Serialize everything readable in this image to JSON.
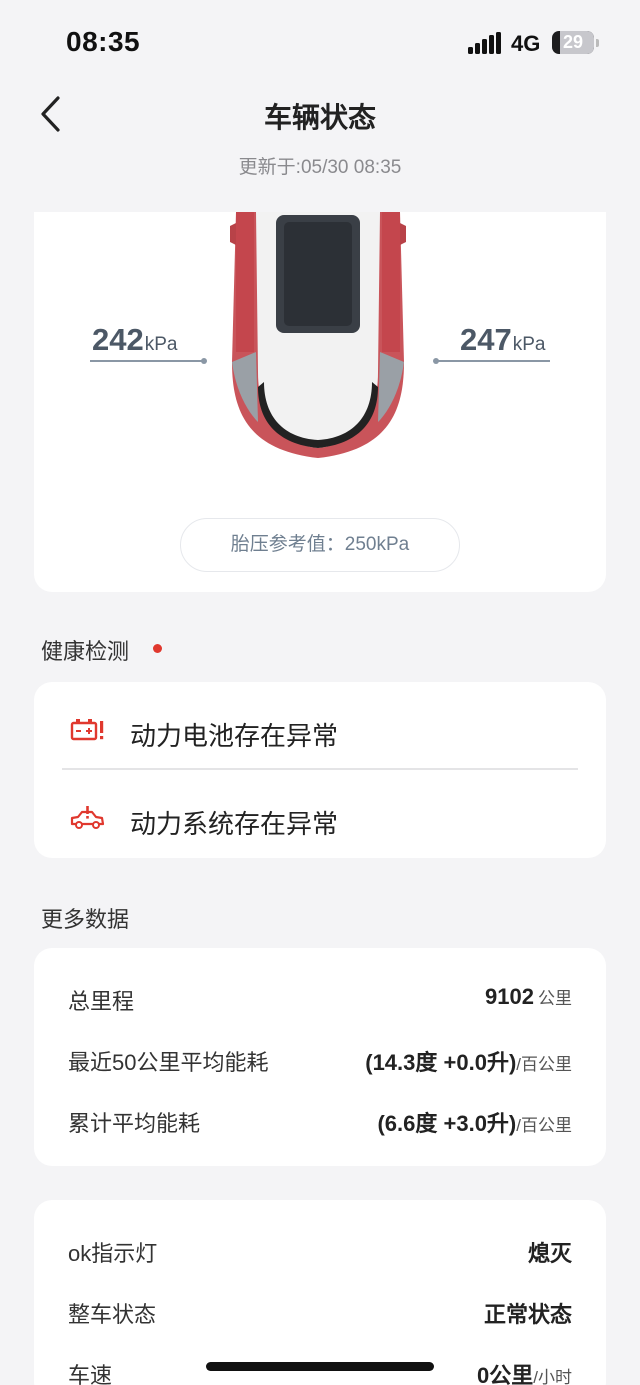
{
  "status_bar": {
    "time": "08:35",
    "network": "4G",
    "battery": "29"
  },
  "header": {
    "title": "车辆状态",
    "update_time": "更新于:05/30 08:35"
  },
  "tire_pressure": {
    "left_value": "242",
    "left_unit": "kPa",
    "right_value": "247",
    "right_unit": "kPa",
    "reference": "胎压参考值：250kPa"
  },
  "health": {
    "section_title": "健康检测",
    "items": [
      {
        "label": "动力电池存在异常",
        "icon": "battery-warning-icon"
      },
      {
        "label": "动力系统存在异常",
        "icon": "car-warning-icon"
      }
    ]
  },
  "more_data": {
    "section_title": "更多数据",
    "rows": [
      {
        "label": "总里程",
        "value": "9102",
        "unit": "公里"
      },
      {
        "label": "最近50公里平均能耗",
        "value": "(14.3度 +0.0升)",
        "unit": "/百公里"
      },
      {
        "label": "累计平均能耗",
        "value": "(6.6度 +3.0升)",
        "unit": "/百公里"
      }
    ]
  },
  "vehicle_status": {
    "rows": [
      {
        "label": "ok指示灯",
        "value": "熄灭",
        "unit": ""
      },
      {
        "label": "整车状态",
        "value": "正常状态",
        "unit": ""
      },
      {
        "label": "车速",
        "value": "0公里",
        "unit": "/小时"
      }
    ]
  },
  "colors": {
    "accent_red": "#e0382e",
    "background": "#f4f4f6",
    "tire_text": "#4c5866"
  }
}
